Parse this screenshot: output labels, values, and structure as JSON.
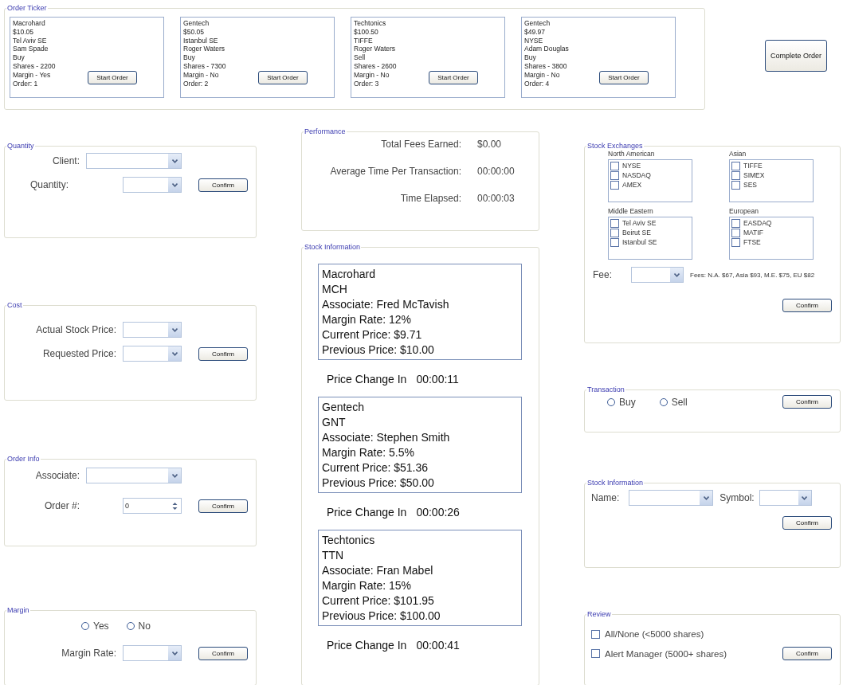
{
  "order_ticker": {
    "title": "Order Ticker",
    "orders": [
      {
        "lines": [
          "Macrohard",
          "$10.05",
          "Tel Aviv SE",
          "Sam Spade",
          "Buy",
          "Shares - 2200",
          "Margin - Yes",
          "Order: 1"
        ],
        "button": "Start Order"
      },
      {
        "lines": [
          "Gentech",
          "$50.05",
          "Istanbul SE",
          "Roger Waters",
          "Buy",
          "Shares - 7300",
          "Margin - No",
          "Order: 2"
        ],
        "button": "Start Order"
      },
      {
        "lines": [
          "Techtonics",
          "$100.50",
          "TIFFE",
          "Roger Waters",
          "Sell",
          "Shares - 2600",
          "Margin - No",
          "Order: 3"
        ],
        "button": "Start Order"
      },
      {
        "lines": [
          "Gentech",
          "$49.97",
          "NYSE",
          "Adam Douglas",
          "Buy",
          "Shares - 3800",
          "Margin - No",
          "Order: 4"
        ],
        "button": "Start Order"
      }
    ]
  },
  "complete_button": "Complete Order",
  "quantity": {
    "title": "Quantity",
    "client_label": "Client:",
    "quantity_label": "Quantity:",
    "button": "Confirm"
  },
  "cost": {
    "title": "Cost",
    "actual_label": "Actual Stock Price:",
    "requested_label": "Requested Price:",
    "button": "Confirm"
  },
  "order_info": {
    "title": "Order Info",
    "associate_label": "Associate:",
    "order_label": "Order #:",
    "order_value": "0",
    "button": "Confirm"
  },
  "margin": {
    "title": "Margin",
    "options": [
      {
        "label": "Yes",
        "selected": false
      },
      {
        "label": "No",
        "selected": false
      }
    ],
    "rate_label": "Margin Rate:",
    "button": "Confirm"
  },
  "performance": {
    "title": "Performance",
    "rows": [
      {
        "label": "Total Fees Earned:",
        "value": "$0.00"
      },
      {
        "label": "Average Time Per Transaction:",
        "value": "00:00:00"
      },
      {
        "label": "Time Elapsed:",
        "value": "00:00:03"
      }
    ]
  },
  "stock_information": {
    "title": "Stock Information",
    "stocks": [
      {
        "lines": [
          "Macrohard",
          "MCH",
          "Associate: Fred McTavish",
          "Margin Rate: 12%",
          "Current Price: $9.71",
          "Previous Price: $10.00"
        ],
        "countdown_label": "Price Change In",
        "countdown": "00:00:11"
      },
      {
        "lines": [
          "Gentech",
          "GNT",
          "Associate: Stephen Smith",
          "Margin Rate: 5.5%",
          "Current Price: $51.36",
          "Previous Price: $50.00"
        ],
        "countdown_label": "Price Change In",
        "countdown": "00:00:26"
      },
      {
        "lines": [
          "Techtonics",
          "TTN",
          "Associate: Fran Mabel",
          "Margin Rate: 15%",
          "Current Price: $101.95",
          "Previous Price: $100.00"
        ],
        "countdown_label": "Price Change In",
        "countdown": "00:00:41"
      }
    ]
  },
  "stock_exchanges": {
    "title": "Stock Exchanges",
    "regions": [
      {
        "name": "North American",
        "items": [
          {
            "label": "NYSE",
            "checked": false
          },
          {
            "label": "NASDAQ",
            "checked": false
          },
          {
            "label": "AMEX",
            "checked": false
          }
        ]
      },
      {
        "name": "Asian",
        "items": [
          {
            "label": "TIFFE",
            "checked": false
          },
          {
            "label": "SIMEX",
            "checked": false
          },
          {
            "label": "SES",
            "checked": false
          }
        ]
      },
      {
        "name": "Middle Eastern",
        "items": [
          {
            "label": "Tel Aviv SE",
            "checked": false
          },
          {
            "label": "Beirut SE",
            "checked": false
          },
          {
            "label": "Istanbul SE",
            "checked": false
          }
        ]
      },
      {
        "name": "European",
        "items": [
          {
            "label": "EASDAQ",
            "checked": false
          },
          {
            "label": "MATIF",
            "checked": false
          },
          {
            "label": "FTSE",
            "checked": false
          }
        ]
      }
    ],
    "fee_label": "Fee:",
    "fee_note": "Fees: N.A. $67, Asia $93, M.E. $75, EU $82",
    "button": "Confirm"
  },
  "transaction": {
    "title": "Transaction",
    "options": [
      {
        "label": "Buy",
        "selected": false
      },
      {
        "label": "Sell",
        "selected": false
      }
    ],
    "button": "Confirm"
  },
  "stock_lookup": {
    "title": "Stock Information",
    "name_label": "Name:",
    "symbol_label": "Symbol:",
    "button": "Confirm"
  },
  "review": {
    "title": "Review",
    "options": [
      {
        "label": "All/None (<5000 shares)",
        "checked": false
      },
      {
        "label": "Alert Manager (5000+ shares)",
        "checked": false
      }
    ],
    "button": "Confirm"
  }
}
